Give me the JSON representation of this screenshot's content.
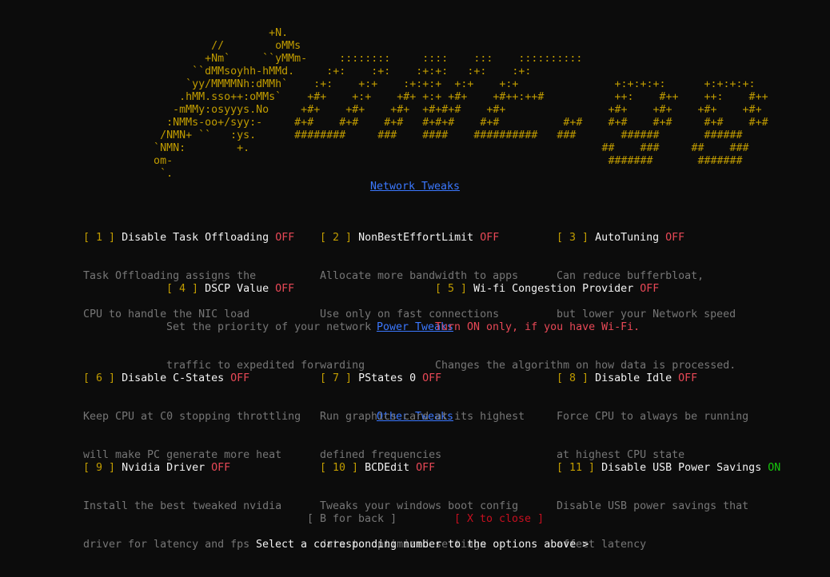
{
  "window": {
    "background": "#0c0c0c"
  },
  "ascii_art": {
    "lines": [
      "                             +N.",
      "                    //        oMMs",
      "                   +Nm`     ``yMMm-     ::::::::     ::::    :::    ::::::::::",
      "                 ``dMMsoyhh-hMMd.     :+:    :+:    :+:+:   :+:    :+:",
      "                `yy/MMMMNh:dMMh`    :+:    +:+    :+:+:+  +:+    +:+               +:+:+:+:      +:+:+:+:",
      "               .hMM.sso++:oMMs`    +#+    +:+    +#+ +:+ +#+    +#++:++#           ++:    #++    ++:    #++",
      "              -mMMy:osyyys.No     +#+    +#+    +#+  +#+#+#    +#+                +#+    +#+    +#+    +#+",
      "             :NMMs-oo+/syy:-     #+#    #+#    #+#   #+#+#    #+#          #+#    #+#    #+#     #+#    #+#",
      "            /NMN+ ``   :ys.      ########     ###    ####    ##########   ###       ######       ######",
      "           `NMN:        +.                                                       ##    ###     ##    ###",
      "           om-                                                                    #######       #######",
      "            `."
    ]
  },
  "sections": {
    "network": {
      "title": "Network Tweaks",
      "options": [
        {
          "num": "1",
          "title": "Disable Task Offloading",
          "state": "OFF",
          "desc": [
            "Task Offloading assigns the",
            "CPU to handle the NIC load"
          ]
        },
        {
          "num": "2",
          "title": "NonBestEffortLimit",
          "state": "OFF",
          "desc": [
            "Allocate more bandwidth to apps",
            "Use only on fast connections"
          ]
        },
        {
          "num": "3",
          "title": "AutoTuning",
          "state": "OFF",
          "desc": [
            "Can reduce bufferbloat,",
            "but lower your Network speed"
          ]
        },
        {
          "num": "4",
          "title": "DSCP Value",
          "state": "OFF",
          "desc": [
            "Set the priority of your network",
            "traffic to expedited forwarding"
          ]
        },
        {
          "num": "5",
          "title": "Wi-fi Congestion Provider",
          "state": "OFF",
          "warning": "Turn ON only, if you have Wi-Fi.",
          "desc": [
            "Changes the algorithm on how data is processed."
          ]
        }
      ]
    },
    "power": {
      "title": "Power Tweaks",
      "options": [
        {
          "num": "6",
          "title": "Disable C-States",
          "state": "OFF",
          "desc": [
            "Keep CPU at C0 stopping throttling",
            "will make PC generate more heat"
          ]
        },
        {
          "num": "7",
          "title": "PStates 0",
          "state": "OFF",
          "desc": [
            "Run graphics card at its highest",
            "defined frequencies"
          ]
        },
        {
          "num": "8",
          "title": "Disable Idle",
          "state": "OFF",
          "desc": [
            "Force CPU to always be running",
            "at highest CPU state"
          ]
        }
      ]
    },
    "other": {
      "title": "Other Tweaks",
      "options": [
        {
          "num": "9",
          "title": "Nvidia Driver",
          "state": "OFF",
          "desc": [
            "Install the best tweaked nvidia",
            "driver for latency and fps"
          ]
        },
        {
          "num": "10",
          "title": "BCDEdit",
          "state": "OFF",
          "desc": [
            "Tweaks your windows boot config",
            "data to optimized settings"
          ]
        },
        {
          "num": "11",
          "title": "Disable USB Power Savings",
          "state": "ON",
          "desc": [
            "Disable USB power savings that",
            "affect latency"
          ]
        }
      ]
    }
  },
  "footer": {
    "back": "[ B for back ]",
    "close": "[ X to close ]",
    "prompt": "Select a corresponding number to the options above >"
  },
  "colors": {
    "bracket": "#c19c00",
    "title": "#f2f2f2",
    "off": "#e74856",
    "on": "#16c60c",
    "desc": "#767676",
    "link": "#3b78ff"
  }
}
